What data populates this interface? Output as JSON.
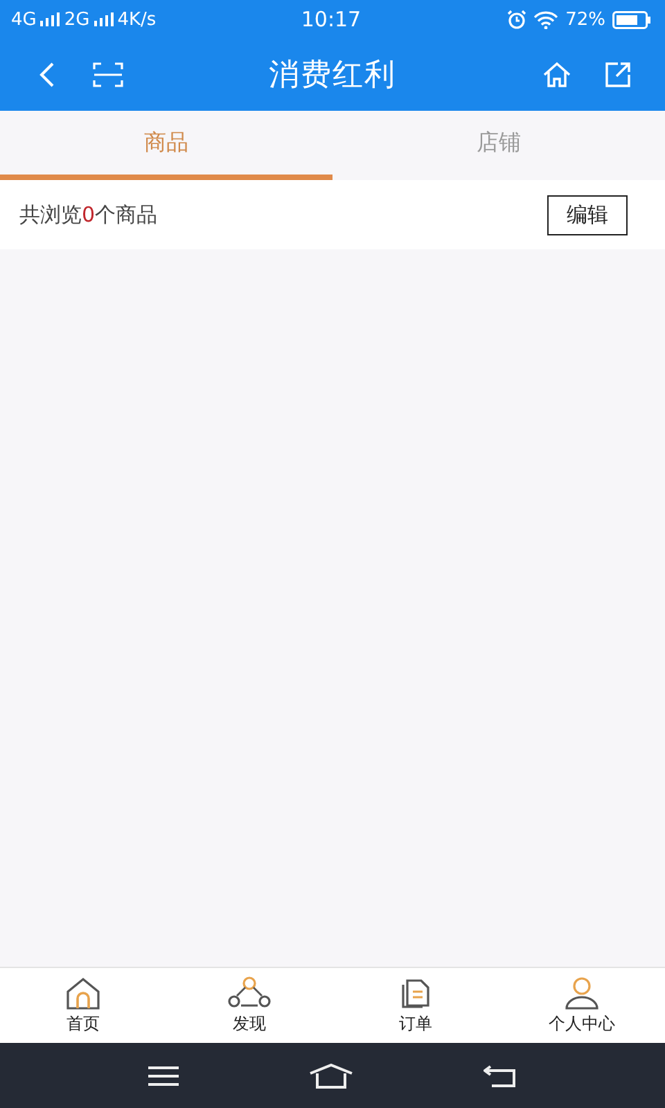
{
  "status_bar": {
    "network_1": "4G",
    "network_2": "2G",
    "speed": "4K/s",
    "time": "10:17",
    "battery": "72%"
  },
  "header": {
    "title": "消费红利"
  },
  "tabs": [
    {
      "label": "商品",
      "selected": true
    },
    {
      "label": "店铺",
      "selected": false
    }
  ],
  "summary": {
    "prefix": "共浏览",
    "count": "0",
    "suffix": "个商品"
  },
  "edit_button": "编辑",
  "bottom_nav": [
    {
      "label": "首页",
      "kind": "home"
    },
    {
      "label": "发现",
      "kind": "discover"
    },
    {
      "label": "订单",
      "kind": "orders"
    },
    {
      "label": "个人中心",
      "kind": "profile"
    }
  ]
}
